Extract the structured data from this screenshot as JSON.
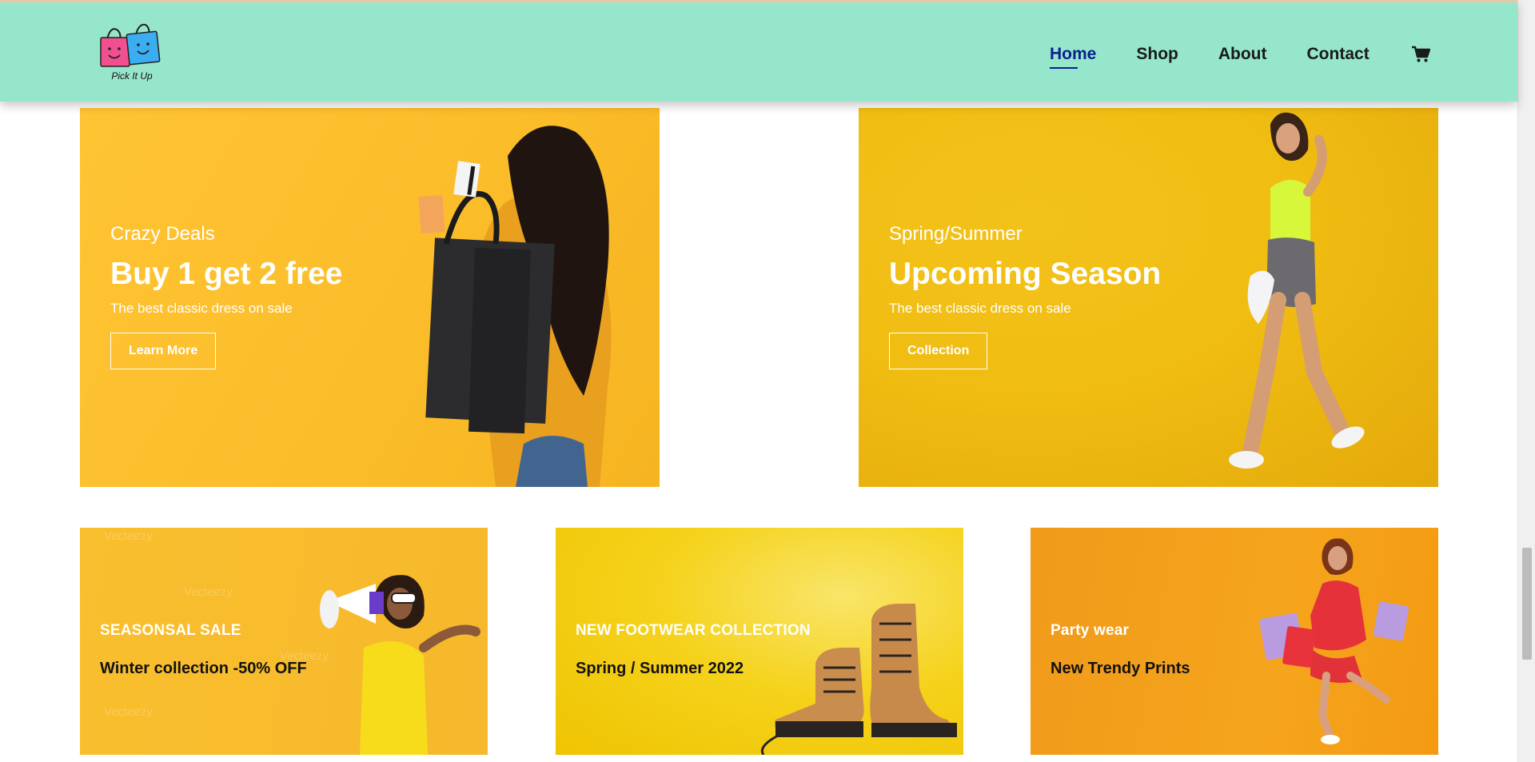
{
  "brand": {
    "logo_text": "Pick It Up",
    "header_color": "#96e6cb"
  },
  "nav": {
    "items": [
      {
        "label": "Home",
        "active": true
      },
      {
        "label": "Shop",
        "active": false
      },
      {
        "label": "About",
        "active": false
      },
      {
        "label": "Contact",
        "active": false
      }
    ],
    "cart_icon": "cart-icon",
    "active_color": "#0b1f8e"
  },
  "banners": [
    {
      "tagline": "Crazy Deals",
      "headline": "Buy 1 get 2 free",
      "subtext": "The best classic dress on sale",
      "button": "Learn More"
    },
    {
      "tagline": "Spring/Summer",
      "headline": "Upcoming Season",
      "subtext": "The best classic dress on sale",
      "button": "Collection"
    }
  ],
  "cards": [
    {
      "title": "SEASONSAL SALE",
      "subtitle": "Winter collection -50% OFF"
    },
    {
      "title": "NEW FOOTWEAR COLLECTION",
      "subtitle": "Spring / Summer 2022"
    },
    {
      "title": "Party wear",
      "subtitle": "New Trendy Prints"
    }
  ],
  "watermark": "Vecteezy",
  "scrollbar": {
    "position_fraction": 0.86
  }
}
